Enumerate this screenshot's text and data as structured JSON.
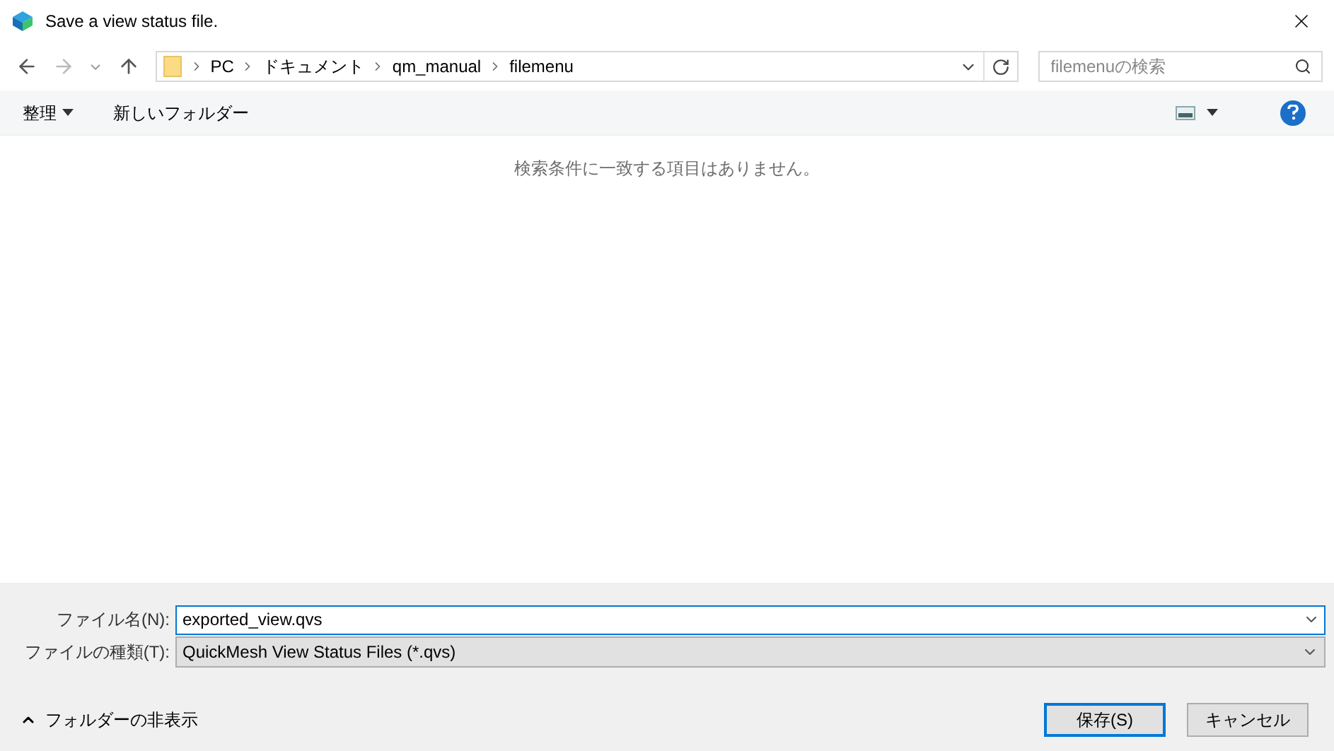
{
  "window": {
    "title": "Save a view status file."
  },
  "breadcrumb": [
    "PC",
    "ドキュメント",
    "qm_manual",
    "filemenu"
  ],
  "search": {
    "placeholder": "filemenuの検索"
  },
  "toolbar": {
    "organize": "整理",
    "new_folder": "新しいフォルダー"
  },
  "content": {
    "empty_message": "検索条件に一致する項目はありません。"
  },
  "file_name": {
    "label": "ファイル名(N):",
    "value": "exported_view.qvs"
  },
  "file_type": {
    "label": "ファイルの種類(T):",
    "value": "QuickMesh View Status Files (*.qvs)"
  },
  "hide_folders": "フォルダーの非表示",
  "buttons": [
    {
      "label": "保存(S)",
      "default": true
    },
    {
      "label": "キャンセル",
      "default": false
    }
  ]
}
